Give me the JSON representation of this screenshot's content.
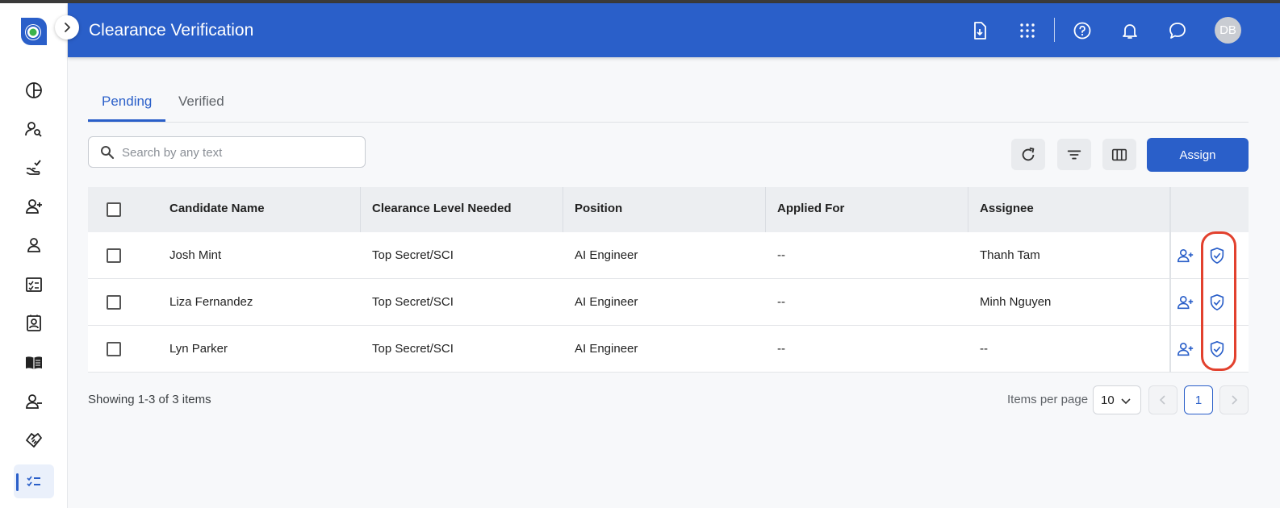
{
  "header": {
    "title": "Clearance Verification",
    "avatar_initials": "DB",
    "icons": [
      "file-download-icon",
      "apps-grid-icon",
      "help-icon",
      "notifications-bell-icon",
      "chat-icon"
    ]
  },
  "sidebar": {
    "items": [
      {
        "icon": "pie-chart-icon"
      },
      {
        "icon": "person-search-icon"
      },
      {
        "icon": "hand-check-icon"
      },
      {
        "icon": "person-add-icon"
      },
      {
        "icon": "person-icon"
      },
      {
        "icon": "checklist-box-icon"
      },
      {
        "icon": "contact-badge-icon"
      },
      {
        "icon": "book-open-icon"
      },
      {
        "icon": "person-remove-icon"
      },
      {
        "icon": "handshake-icon"
      },
      {
        "icon": "task-list-icon",
        "active": true
      }
    ]
  },
  "tabs": [
    {
      "label": "Pending",
      "active": true
    },
    {
      "label": "Verified",
      "active": false
    }
  ],
  "search": {
    "placeholder": "Search by any text",
    "value": ""
  },
  "toolbar": {
    "assign_label": "Assign"
  },
  "table": {
    "columns": [
      "Candidate Name",
      "Clearance Level Needed",
      "Position",
      "Applied For",
      "Assignee"
    ],
    "rows": [
      {
        "name": "Josh Mint",
        "clearance": "Top Secret/SCI",
        "position": "AI Engineer",
        "applied_for": "--",
        "assignee": "Thanh Tam"
      },
      {
        "name": "Liza Fernandez",
        "clearance": "Top Secret/SCI",
        "position": "AI Engineer",
        "applied_for": "--",
        "assignee": "Minh Nguyen"
      },
      {
        "name": "Lyn Parker",
        "clearance": "Top Secret/SCI",
        "position": "AI Engineer",
        "applied_for": "--",
        "assignee": "--"
      }
    ]
  },
  "footer": {
    "showing": "Showing 1-3 of 3 items",
    "items_per_page_label": "Items per page",
    "items_per_page": "10",
    "current_page": "1"
  },
  "colors": {
    "primary": "#2a5fc9",
    "highlight": "#e2412e"
  }
}
